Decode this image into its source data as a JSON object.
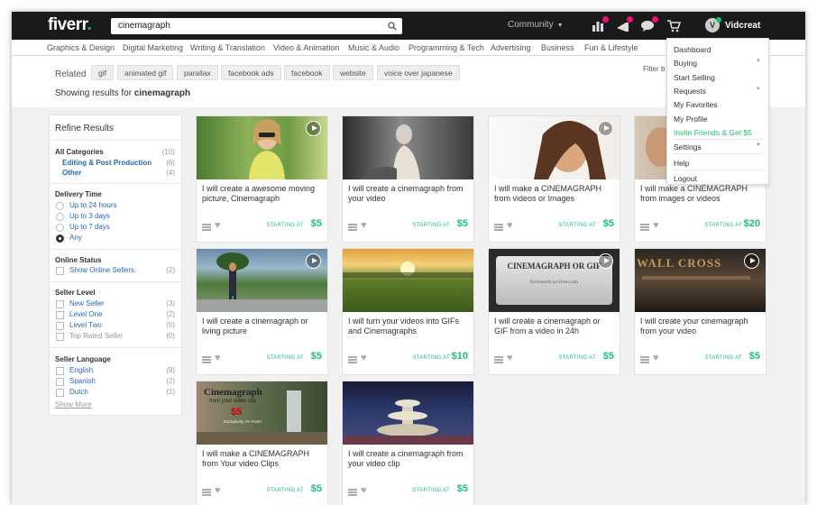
{
  "header": {
    "logo": "fiverr",
    "search_value": "cinemagraph",
    "community_label": "Community",
    "username": "Vidcreat",
    "avatar_letter": "V",
    "icons": [
      "stats-icon",
      "notifications-icon",
      "messages-icon",
      "cart-icon"
    ]
  },
  "categories": [
    "Graphics & Design",
    "Digital Marketing",
    "Writing & Translation",
    "Video & Animation",
    "Music & Audio",
    "Programming & Tech",
    "Advertising",
    "Business",
    "Fun & Lifestyle"
  ],
  "related": {
    "label": "Related",
    "tags": [
      "gif",
      "animated gif",
      "parallax",
      "facebook ads",
      "facebook",
      "website",
      "voice over japanese"
    ],
    "showing_prefix": "Showing results for",
    "query": "cinemagraph",
    "filter_label": "Filter b"
  },
  "sidebar": {
    "title": "Refine Results",
    "all_categories": {
      "label": "All Categories",
      "count": "(10)"
    },
    "subcats": [
      {
        "label": "Editing & Post Production",
        "count": "(6)"
      },
      {
        "label": "Other",
        "count": "(4)"
      }
    ],
    "delivery": {
      "title": "Delivery Time",
      "options": [
        "Up to 24 hours",
        "Up to 3 days",
        "Up to 7 days",
        "Any"
      ],
      "selected": "Any"
    },
    "online": {
      "title": "Online Status",
      "options": [
        {
          "label": "Show Online Sellers",
          "count": "(2)"
        }
      ]
    },
    "level": {
      "title": "Seller Level",
      "options": [
        {
          "label": "New Seller",
          "count": "(3)"
        },
        {
          "label": "Level One",
          "count": "(2)"
        },
        {
          "label": "Level Two",
          "count": "(5)"
        },
        {
          "label": "Top Rated Seller",
          "count": "(0)"
        }
      ]
    },
    "language": {
      "title": "Seller Language",
      "options": [
        {
          "label": "English",
          "count": "(9)"
        },
        {
          "label": "Spanish",
          "count": "(2)"
        },
        {
          "label": "Dutch",
          "count": "(1)"
        }
      ]
    },
    "show_more": "Show More"
  },
  "gigs": [
    {
      "title": "I will create a awesome moving picture, Cinemagraph",
      "price": "$5"
    },
    {
      "title": "I will create a cinemagraph from your video",
      "price": "$5"
    },
    {
      "title": "I will make a CINEMAGRAPH from videos or Images",
      "price": "$5"
    },
    {
      "title": "I will make a CINEMAGRAPH from images or videos",
      "price": "$20"
    },
    {
      "title": "I will create a cinemagraph or living picture",
      "price": "$5"
    },
    {
      "title": "I will turn your videos into GIFs and Cinemagraphs",
      "price": "$10"
    },
    {
      "title": "I will create a cinemagraph or GIF from a video in 24h",
      "price": "$5"
    },
    {
      "title": "I will create your cinemagraph from your video",
      "price": "$5"
    },
    {
      "title": "I will make a CINEMAGRAPH from Your video Clips",
      "price": "$5"
    },
    {
      "title": "I will create a cinemagraph from your video clip",
      "price": "$5"
    }
  ],
  "starting_at": "STARTING AT",
  "thumb_text": {
    "g7": "CINEMAGRAPH OR GIF",
    "g7_sub": "Exclusively on Fiverr.com",
    "g8": "WALL CROSS",
    "g9_title": "Cinemagraph",
    "g9_sub": "from your video clip",
    "g9_price": "$5",
    "g9_small": "Exclusively On Fiverr"
  },
  "dropdown": {
    "items": [
      {
        "label": "Dashboard"
      },
      {
        "label": "Buying",
        "caret": true
      },
      {
        "label": "Start Selling"
      },
      {
        "label": "Requests",
        "caret": true
      },
      {
        "label": "My Favorites"
      },
      {
        "label": "My Profile"
      },
      {
        "label": "Invite Friends & Get $5",
        "accent": true
      },
      {
        "label": "Settings",
        "caret": true
      },
      {
        "label": "Help"
      },
      {
        "label": "Logout"
      }
    ]
  },
  "colors": {
    "accent": "#1dbf73",
    "link": "#2769b5",
    "topbar": "#1a1a1a",
    "badge": "#e8127a"
  }
}
